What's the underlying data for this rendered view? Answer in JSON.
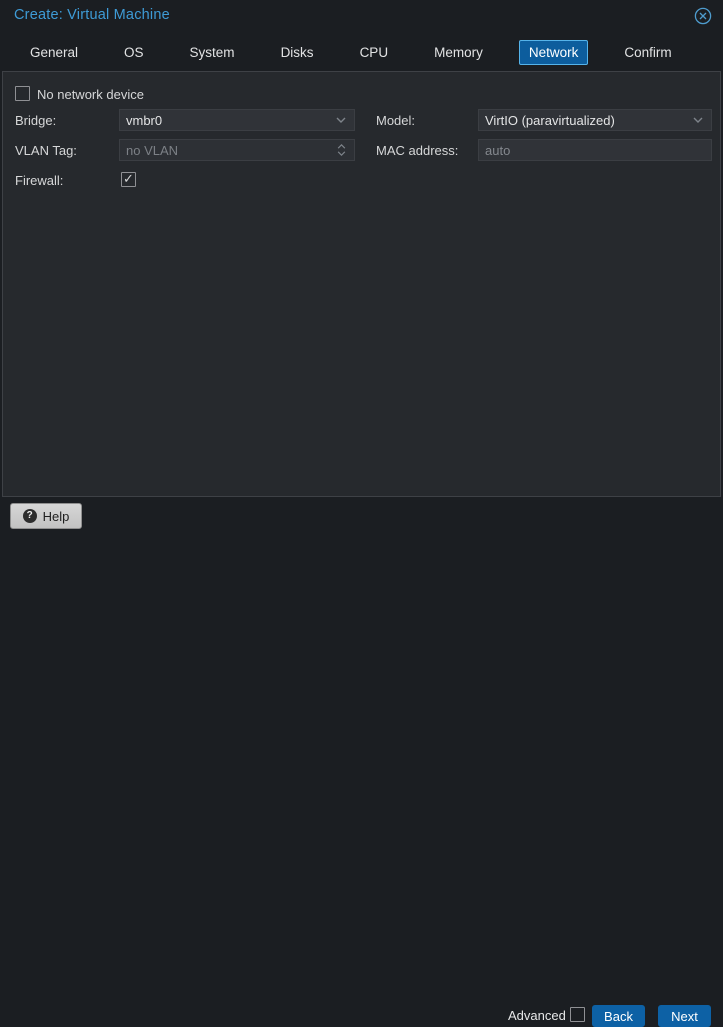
{
  "colors": {
    "accent_blue": "#3e9bd6",
    "button_blue": "#0d61a5",
    "active_tab_fill": "#0d5d9d",
    "active_tab_border": "#55b3ea",
    "panel_bg": "#26292d",
    "window_bg": "#1b1e22"
  },
  "window": {
    "title": "Create: Virtual Machine",
    "close_icon": "circle-x-icon"
  },
  "tabs": [
    {
      "label": "General",
      "active": false
    },
    {
      "label": "OS",
      "active": false
    },
    {
      "label": "System",
      "active": false
    },
    {
      "label": "Disks",
      "active": false
    },
    {
      "label": "CPU",
      "active": false
    },
    {
      "label": "Memory",
      "active": false
    },
    {
      "label": "Network",
      "active": true
    },
    {
      "label": "Confirm",
      "active": false
    }
  ],
  "form": {
    "no_network_device": {
      "label": "No network device",
      "checked": false
    },
    "bridge": {
      "label": "Bridge:",
      "value": "vmbr0",
      "type": "combobox"
    },
    "vlan_tag": {
      "label": "VLAN Tag:",
      "value": "",
      "placeholder": "no VLAN",
      "type": "number-spinner",
      "disabled": true
    },
    "firewall": {
      "label": "Firewall:",
      "checked": true
    },
    "model": {
      "label": "Model:",
      "value": "VirtIO (paravirtualized)",
      "type": "combobox"
    },
    "mac_address": {
      "label": "MAC address:",
      "value": "",
      "placeholder": "auto",
      "type": "text"
    }
  },
  "footer": {
    "help_label": "Help",
    "advanced_label": "Advanced",
    "advanced_checked": false,
    "back_label": "Back",
    "next_label": "Next"
  }
}
